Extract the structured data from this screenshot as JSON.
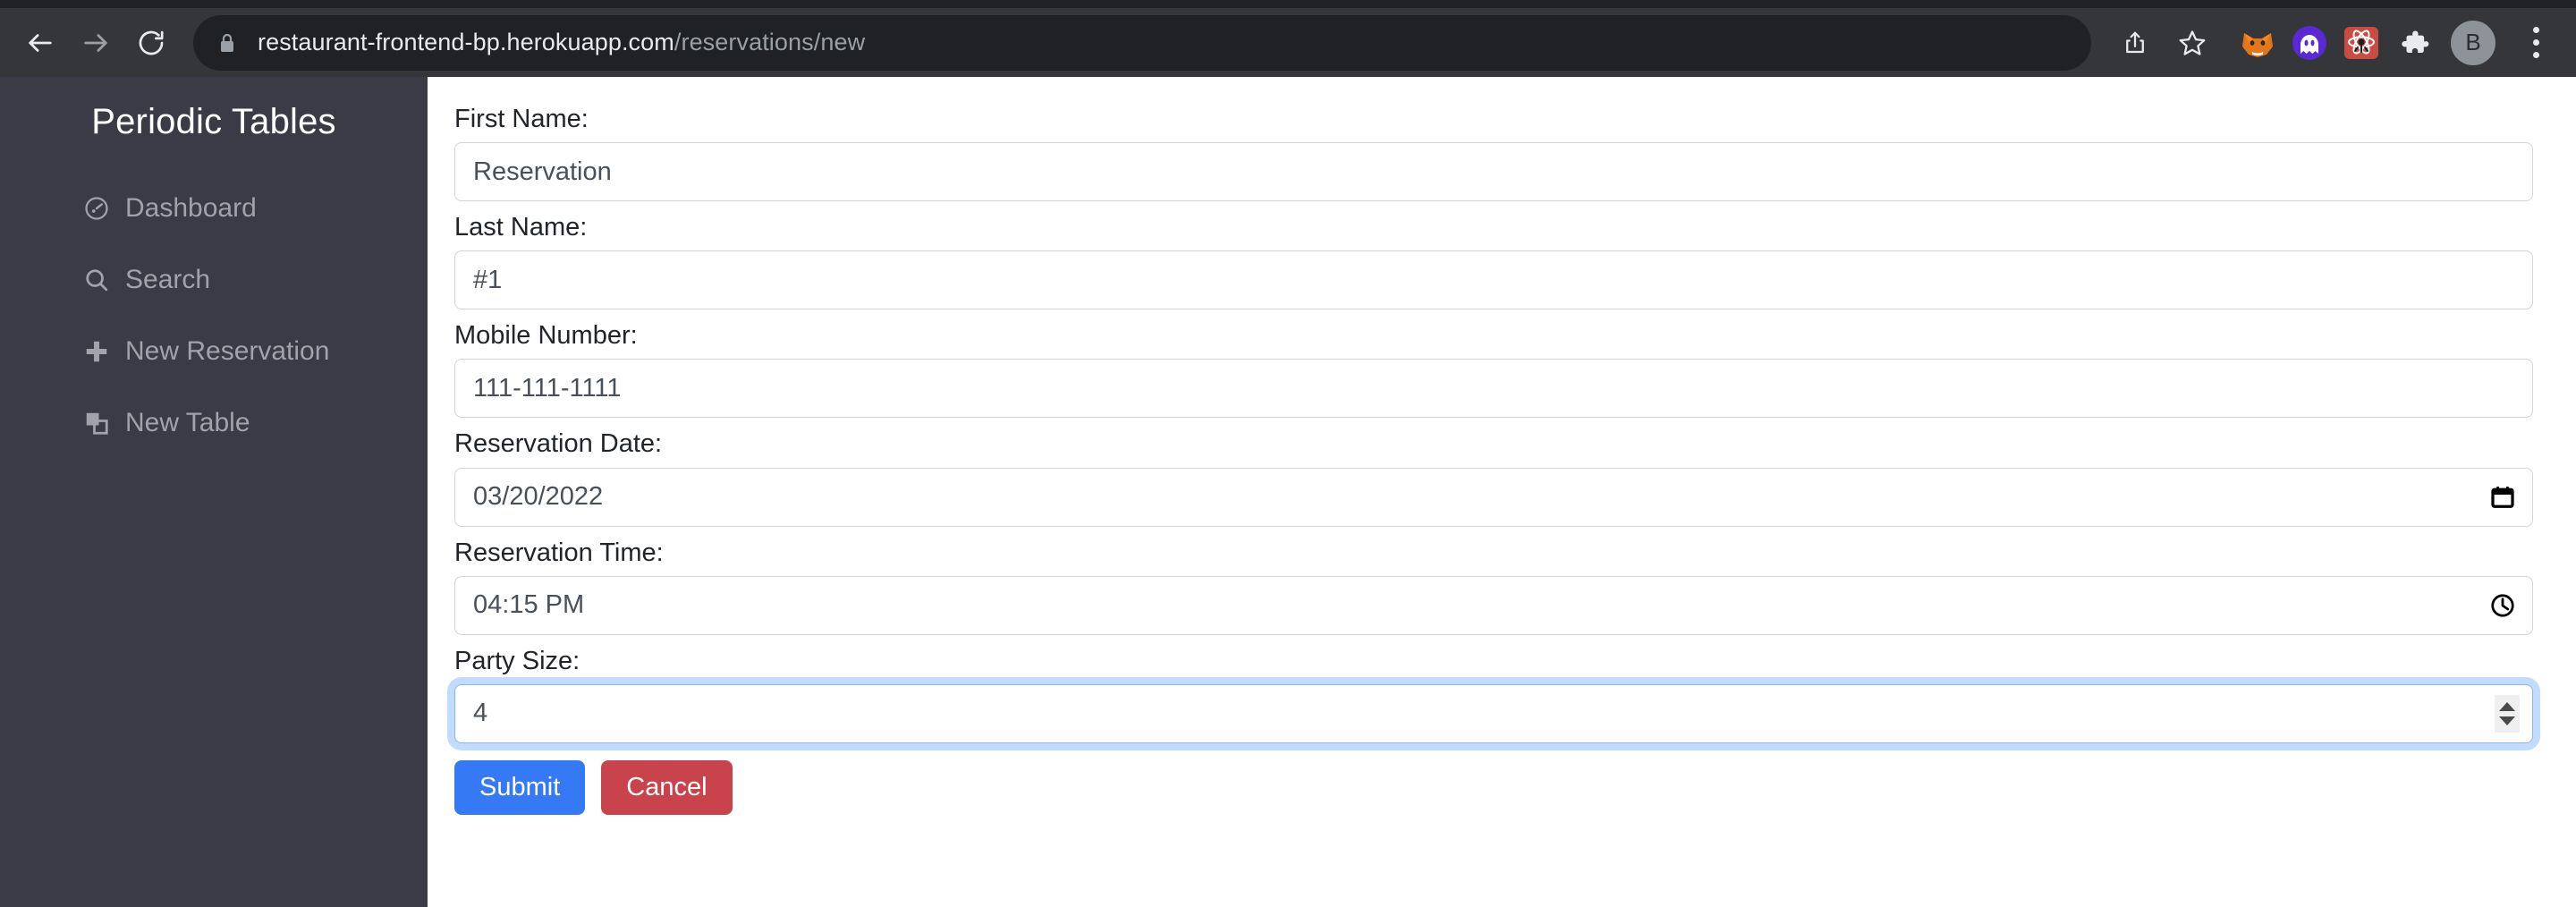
{
  "browser": {
    "back_label": "Back",
    "forward_label": "Forward",
    "reload_label": "Reload",
    "lock_icon": "lock-icon",
    "url_main": "restaurant-frontend-bp.herokuapp.com",
    "url_path": "/reservations/new",
    "share_label": "Share",
    "bookmark_label": "Bookmark this tab",
    "extensions": [
      {
        "name": "metamask-extension-icon",
        "label": "MetaMask"
      },
      {
        "name": "ghost-extension-icon",
        "label": "Ghost"
      },
      {
        "name": "react-devtools-extension-icon",
        "label": "React Developer Tools"
      },
      {
        "name": "puzzle-extensions-icon",
        "label": "Extensions"
      }
    ],
    "profile_initial": "B",
    "menu_label": "Customize and control Google Chrome"
  },
  "sidebar": {
    "title": "Periodic Tables",
    "items": [
      {
        "label": "Dashboard",
        "icon": "dashboard-icon"
      },
      {
        "label": "Search",
        "icon": "search-icon"
      },
      {
        "label": "New Reservation",
        "icon": "plus-icon"
      },
      {
        "label": "New Table",
        "icon": "layers-icon"
      }
    ]
  },
  "form": {
    "fields": [
      {
        "label": "First Name:",
        "value": "Reservation",
        "type": "text",
        "indicator": null,
        "focused": false
      },
      {
        "label": "Last Name:",
        "value": "#1",
        "type": "text",
        "indicator": null,
        "focused": false
      },
      {
        "label": "Mobile Number:",
        "value": "111-111-1111",
        "type": "tel",
        "indicator": null,
        "focused": false
      },
      {
        "label": "Reservation Date:",
        "value": "03/20/2022",
        "type": "date",
        "indicator": "calendar-icon",
        "focused": false
      },
      {
        "label": "Reservation Time:",
        "value": "04:15 PM",
        "type": "time",
        "indicator": "clock-icon",
        "focused": false
      },
      {
        "label": "Party Size:",
        "value": "4",
        "type": "number",
        "indicator": "number-spinner",
        "focused": true
      }
    ],
    "submit_label": "Submit",
    "cancel_label": "Cancel"
  },
  "colors": {
    "sidebar_bg": "#3b3b47",
    "toolbar_bg": "#35363a",
    "omnibox_bg": "#202124",
    "submit_blue": "#3679f5",
    "cancel_red": "#c8434c",
    "input_border": "#ced4da",
    "focus_ring": "#86b7fe",
    "label_text": "#212529",
    "input_text": "#495057",
    "nav_text": "#a2a2ad"
  }
}
